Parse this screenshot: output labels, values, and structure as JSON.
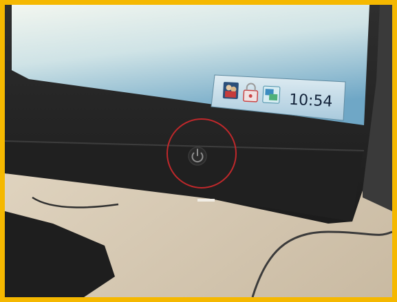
{
  "taskbar": {
    "clock_time": "10:54",
    "tray_icons": [
      "user-accounts-icon",
      "security-lock-icon",
      "network-icon"
    ]
  },
  "annotation": {
    "highlight_target": "power-button",
    "highlight_color": "#c0282b"
  },
  "colors": {
    "frame_border": "#f5b800",
    "screen_top": "#eef3ec",
    "screen_bottom": "#7fb2cc",
    "bezel": "#262626",
    "desk": "#dfd4c2"
  },
  "icons": {
    "power_button": "power-icon"
  }
}
